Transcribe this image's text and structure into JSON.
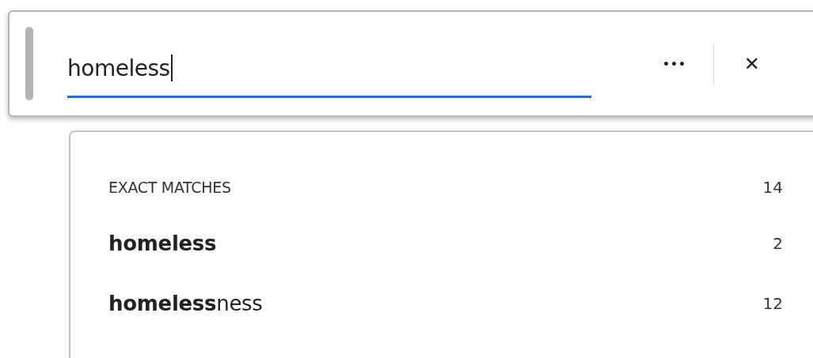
{
  "search": {
    "value": "homeless",
    "focused": true
  },
  "toolbar": [
    {
      "kind": "more",
      "label": "•••"
    },
    {
      "kind": "close",
      "label": "✕"
    }
  ],
  "results": {
    "heading": "EXACT MATCHES",
    "count": "14",
    "items": [
      {
        "match": "homeless",
        "count": "2"
      },
      {
        "match": "homeless",
        "suffix": "ness",
        "count": "12"
      }
    ]
  }
}
